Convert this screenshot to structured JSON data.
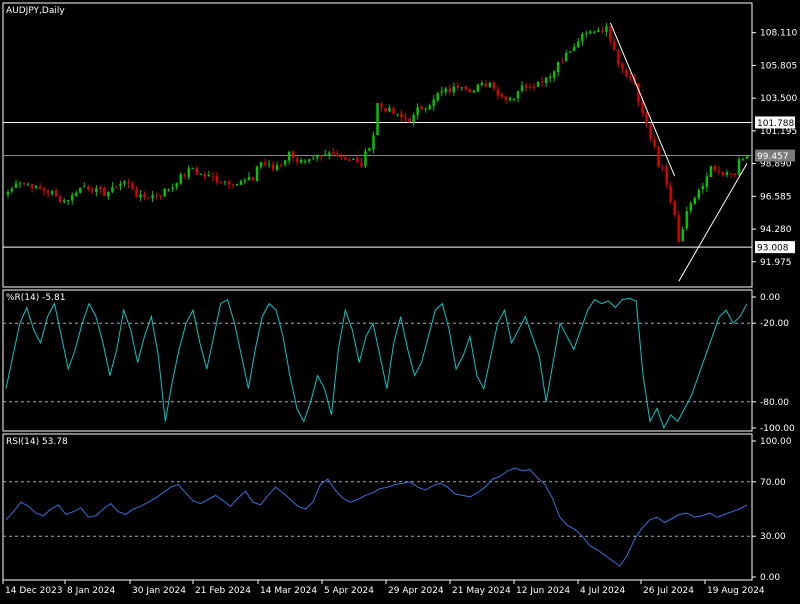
{
  "colors": {
    "background": "#000000",
    "frame": "#ffffff",
    "bull": "#00c800",
    "bear": "#e00000",
    "oscillator": "#00c8c8",
    "rsi": "#3a6fd8",
    "trendline": "#ffffff",
    "level_line": "#ffffff",
    "current_line": "#8a8a8a",
    "dash_line": "#aaaaaa"
  },
  "chart_data": [
    {
      "type": "candlestick",
      "title": "AUDJPY,Daily",
      "ylim": [
        90.2,
        110.2
      ],
      "y_ticks": [
        "108.110",
        "105.805",
        "103.500",
        "101.195",
        "98.890",
        "96.585",
        "94.280",
        "91.975"
      ],
      "horizontal_levels": [
        {
          "value": 101.788,
          "label": "101.788"
        },
        {
          "value": 93.008,
          "label": "93.008"
        }
      ],
      "current_price": {
        "value": 99.457,
        "label": "99.457"
      },
      "trendlines": [
        {
          "from": [
            0,
            108.8
          ],
          "to": [
            0,
            98.0
          ]
        },
        {
          "from": [
            0,
            90.6
          ],
          "to": [
            0,
            98.9
          ]
        }
      ],
      "anchors": [
        {
          "date": "2023-12-14",
          "close": 96.9
        },
        {
          "date": "2023-12-18",
          "close": 97.7
        },
        {
          "date": "2023-12-27",
          "close": 97.0
        },
        {
          "date": "2024-01-03",
          "close": 96.3
        },
        {
          "date": "2024-01-10",
          "close": 97.3
        },
        {
          "date": "2024-01-17",
          "close": 96.8
        },
        {
          "date": "2024-01-24",
          "close": 97.6
        },
        {
          "date": "2024-01-30",
          "close": 96.5
        },
        {
          "date": "2024-02-06",
          "close": 96.8
        },
        {
          "date": "2024-02-13",
          "close": 97.9
        },
        {
          "date": "2024-02-16",
          "close": 98.6
        },
        {
          "date": "2024-02-21",
          "close": 98.0
        },
        {
          "date": "2024-02-27",
          "close": 97.7
        },
        {
          "date": "2024-03-04",
          "close": 97.5
        },
        {
          "date": "2024-03-08",
          "close": 97.8
        },
        {
          "date": "2024-03-12",
          "close": 99.0
        },
        {
          "date": "2024-03-15",
          "close": 98.5
        },
        {
          "date": "2024-03-19",
          "close": 98.9
        },
        {
          "date": "2024-03-21",
          "close": 99.6
        },
        {
          "date": "2024-03-27",
          "close": 98.9
        },
        {
          "date": "2024-04-02",
          "close": 99.3
        },
        {
          "date": "2024-04-05",
          "close": 99.8
        },
        {
          "date": "2024-04-11",
          "close": 99.2
        },
        {
          "date": "2024-04-16",
          "close": 98.8
        },
        {
          "date": "2024-04-22",
          "close": 103.1
        },
        {
          "date": "2024-04-26",
          "close": 102.4
        },
        {
          "date": "2024-05-02",
          "close": 102.0
        },
        {
          "date": "2024-05-08",
          "close": 103.0
        },
        {
          "date": "2024-05-14",
          "close": 103.9
        },
        {
          "date": "2024-05-21",
          "close": 104.5
        },
        {
          "date": "2024-05-24",
          "close": 104.0
        },
        {
          "date": "2024-05-30",
          "close": 104.6
        },
        {
          "date": "2024-06-04",
          "close": 103.6
        },
        {
          "date": "2024-06-07",
          "close": 103.6
        },
        {
          "date": "2024-06-12",
          "close": 104.4
        },
        {
          "date": "2024-06-17",
          "close": 104.6
        },
        {
          "date": "2024-06-21",
          "close": 105.4
        },
        {
          "date": "2024-06-27",
          "close": 106.8
        },
        {
          "date": "2024-07-02",
          "close": 107.8
        },
        {
          "date": "2024-07-05",
          "close": 108.3
        },
        {
          "date": "2024-07-10",
          "close": 108.4
        },
        {
          "date": "2024-07-12",
          "close": 107.1
        },
        {
          "date": "2024-07-17",
          "close": 105.3
        },
        {
          "date": "2024-07-22",
          "close": 103.3
        },
        {
          "date": "2024-07-25",
          "close": 100.6
        },
        {
          "date": "2024-07-30",
          "close": 98.4
        },
        {
          "date": "2024-08-02",
          "close": 95.1
        },
        {
          "date": "2024-08-05",
          "close": 93.3
        },
        {
          "date": "2024-08-07",
          "close": 95.3
        },
        {
          "date": "2024-08-09",
          "close": 96.5
        },
        {
          "date": "2024-08-13",
          "close": 97.2
        },
        {
          "date": "2024-08-15",
          "close": 98.5
        },
        {
          "date": "2024-08-20",
          "close": 98.0
        },
        {
          "date": "2024-08-23",
          "close": 98.3
        },
        {
          "date": "2024-08-28",
          "close": 99.4
        }
      ]
    },
    {
      "type": "line",
      "title": "%R(14) -5.81",
      "ylim": [
        -100,
        0
      ],
      "y_ticks": [
        "0.00",
        "-20.00",
        "-80.00",
        "-100.00"
      ],
      "levels": [
        -20,
        -80
      ],
      "values": [
        -70,
        -45,
        -20,
        -8,
        -25,
        -35,
        -15,
        -5,
        -30,
        -55,
        -40,
        -20,
        -5,
        -15,
        -35,
        -60,
        -40,
        -10,
        -25,
        -50,
        -30,
        -15,
        -45,
        -95,
        -65,
        -40,
        -20,
        -10,
        -35,
        -55,
        -30,
        -5,
        -2,
        -20,
        -45,
        -70,
        -40,
        -15,
        -5,
        -10,
        -30,
        -60,
        -85,
        -95,
        -80,
        -60,
        -70,
        -90,
        -40,
        -10,
        -25,
        -50,
        -30,
        -20,
        -45,
        -70,
        -35,
        -15,
        -40,
        -60,
        -50,
        -30,
        -10,
        -5,
        -25,
        -55,
        -45,
        -30,
        -60,
        -70,
        -45,
        -20,
        -10,
        -35,
        -25,
        -15,
        -30,
        -45,
        -80,
        -50,
        -20,
        -30,
        -40,
        -25,
        -10,
        -2,
        -5,
        -3,
        -8,
        -2,
        -1,
        -3,
        -60,
        -95,
        -85,
        -100,
        -90,
        -95,
        -85,
        -75,
        -60,
        -45,
        -30,
        -15,
        -10,
        -20,
        -15,
        -5
      ]
    },
    {
      "type": "line",
      "title": "RSI(14) 53.78",
      "ylim": [
        0,
        100
      ],
      "y_ticks": [
        "100.00",
        "70.00",
        "30.00",
        "0.00"
      ],
      "levels": [
        70,
        30
      ],
      "values": [
        42,
        48,
        55,
        52,
        47,
        45,
        50,
        53,
        46,
        48,
        51,
        44,
        45,
        50,
        54,
        48,
        46,
        50,
        52,
        55,
        58,
        62,
        66,
        68,
        62,
        56,
        54,
        57,
        60,
        56,
        52,
        58,
        63,
        55,
        53,
        60,
        66,
        62,
        57,
        52,
        50,
        55,
        68,
        72,
        64,
        58,
        55,
        57,
        60,
        62,
        65,
        66,
        68,
        69,
        70,
        66,
        64,
        67,
        69,
        66,
        61,
        60,
        59,
        62,
        66,
        72,
        74,
        78,
        80,
        78,
        79,
        73,
        68,
        58,
        44,
        38,
        35,
        30,
        23,
        20,
        16,
        12,
        8,
        16,
        28,
        36,
        42,
        44,
        40,
        43,
        46,
        47,
        44,
        45,
        47,
        44,
        46,
        48,
        50,
        53
      ]
    }
  ],
  "x_axis_labels": [
    "14 Dec 2023",
    "8 Jan 2024",
    "30 Jan 2024",
    "21 Feb 2024",
    "14 Mar 2024",
    "5 Apr 2024",
    "29 Apr 2024",
    "21 May 2024",
    "12 Jun 2024",
    "4 Jul 2024",
    "26 Jul 2024",
    "19 Aug 2024"
  ]
}
